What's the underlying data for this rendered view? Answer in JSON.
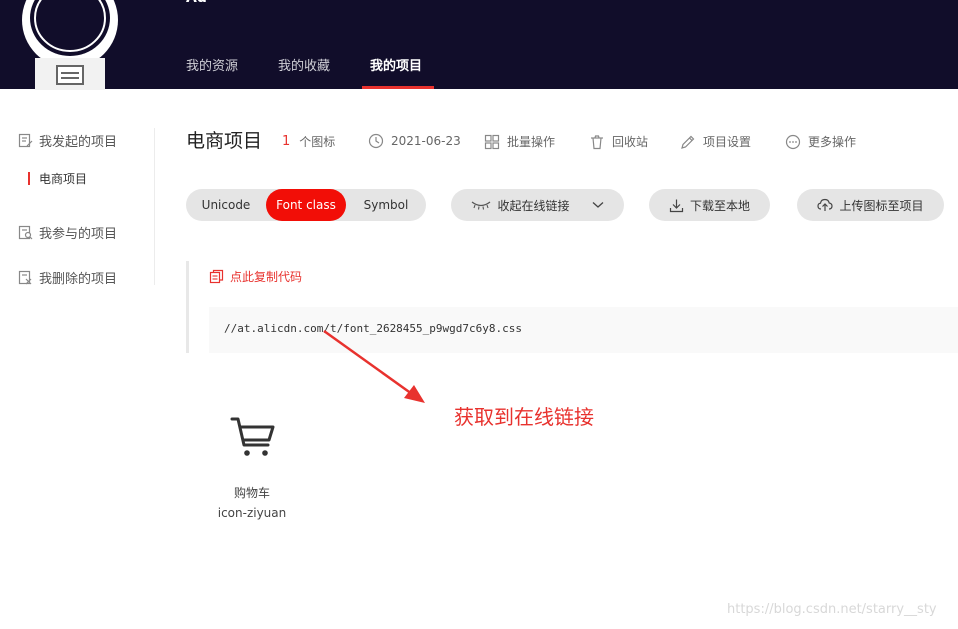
{
  "header": {
    "user_name": "Ad",
    "tabs": [
      {
        "label": "我的资源"
      },
      {
        "label": "我的收藏"
      },
      {
        "label": "我的项目"
      }
    ]
  },
  "sidebar": {
    "items": [
      {
        "label": "我发起的项目",
        "icon": "doc-edit-icon"
      },
      {
        "label": "我参与的项目",
        "icon": "doc-search-icon"
      },
      {
        "label": "我删除的项目",
        "icon": "doc-delete-icon"
      }
    ],
    "sub_item": "电商项目"
  },
  "project": {
    "title": "电商项目",
    "icon_count": "1",
    "icon_count_label": "个图标",
    "date": "2021-06-23",
    "actions": {
      "batch": "批量操作",
      "recycle": "回收站",
      "settings": "项目设置",
      "more": "更多操作"
    }
  },
  "format_tabs": [
    "Unicode",
    "Font class",
    "Symbol"
  ],
  "buttons": {
    "collapse_link": "收起在线链接",
    "download": "下载至本地",
    "upload": "上传图标至项目"
  },
  "code": {
    "copy_label": "点此复制代码",
    "url": "//at.alicdn.com/t/font_2628455_p9wgd7c6y8.css"
  },
  "annotation": "获取到在线链接",
  "icons": [
    {
      "name": "购物车",
      "class_name": "icon-ziyuan",
      "glyph": "shopping-cart-icon"
    }
  ],
  "watermark": "https://blog.csdn.net/starry__sty",
  "colors": {
    "header_bg": "#110d2a",
    "accent": "#e8322e",
    "active_tab": "#f20e07"
  }
}
